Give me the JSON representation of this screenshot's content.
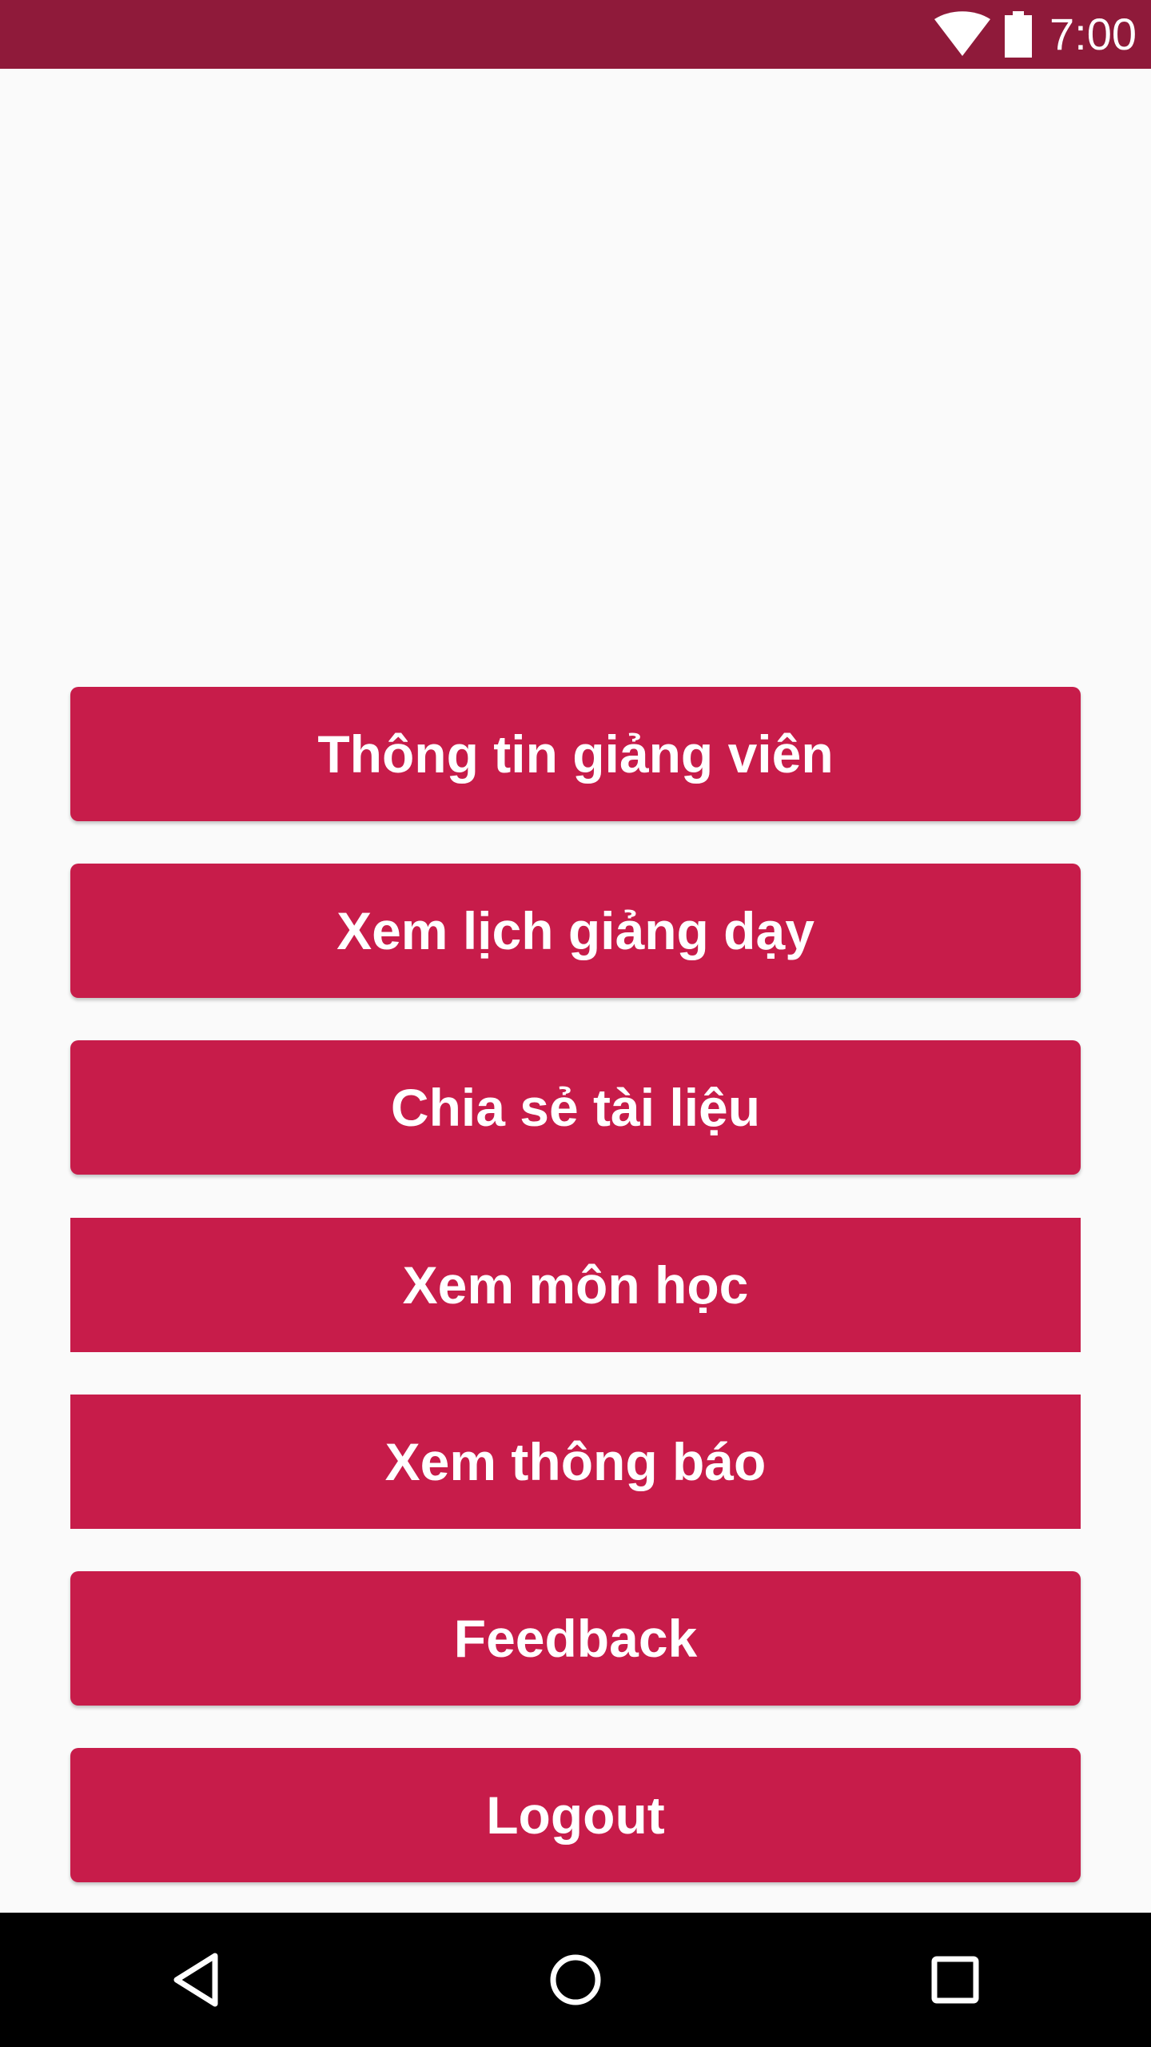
{
  "status_bar": {
    "time": "7:00",
    "icons": [
      "wifi-icon",
      "battery-icon"
    ],
    "background": "#8f1a3a"
  },
  "menu": {
    "button_color": "#c71c4a",
    "buttons": [
      {
        "label": "Thông tin giảng viên"
      },
      {
        "label": "Xem lịch giảng dạy"
      },
      {
        "label": "Chia sẻ tài liệu"
      },
      {
        "label": "Xem môn học"
      },
      {
        "label": "Xem thông báo"
      },
      {
        "label": "Feedback"
      },
      {
        "label": "Logout"
      }
    ]
  },
  "nav_bar": {
    "icons": [
      "back-icon",
      "home-icon",
      "recents-icon"
    ]
  }
}
